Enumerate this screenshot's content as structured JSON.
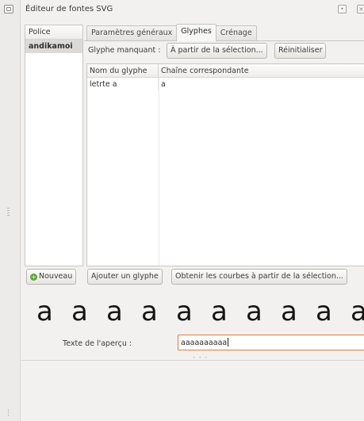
{
  "window": {
    "title": "Éditeur de fontes SVG"
  },
  "fontlist": {
    "header": "Police",
    "items": [
      "andikamoi"
    ]
  },
  "tabs": [
    {
      "label": "Paramètres généraux"
    },
    {
      "label": "Glyphes"
    },
    {
      "label": "Crénage"
    }
  ],
  "glyphs_tab": {
    "missing_glyph_label": "Glyphe manquant :",
    "from_selection_button": "À partir de la sélection...",
    "reset_button": "Réinitialiser",
    "table": {
      "columns": [
        "Nom du glyphe",
        "Chaîne correspondante"
      ],
      "rows": [
        {
          "name": "letrte a",
          "string": "a"
        }
      ]
    }
  },
  "buttons": {
    "new": "Nouveau",
    "add_glyph": "Ajouter un glyphe",
    "get_curves": "Obtenir les courbes à partir de la sélection..."
  },
  "preview": {
    "glyphs": [
      "a",
      "a",
      "a",
      "a",
      "a",
      "a",
      "a",
      "a",
      "a",
      "a"
    ],
    "label": "Texte de l'aperçu :",
    "text": "aaaaaaaaaa"
  },
  "icons": {
    "dock": "dock-window-icon",
    "new": "plus-icon"
  },
  "colors": {
    "input_focus": "#e07a3f",
    "selected_row": "#dcdad6",
    "new_icon": "#5fa33a"
  }
}
